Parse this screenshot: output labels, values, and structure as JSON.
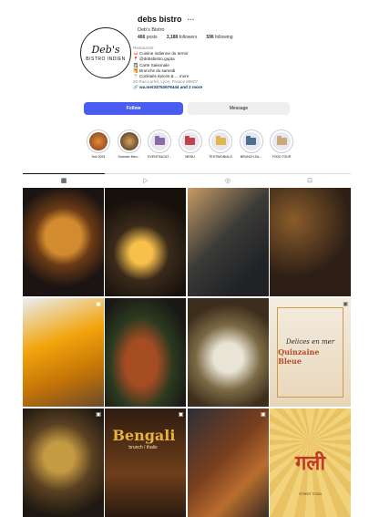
{
  "profile": {
    "username": "debs bistro",
    "more_icon": "ellipsis-icon",
    "full_name": "Deb's Bistro",
    "avatar_line1": "Deb's",
    "avatar_line2": "BISTRO INDIEN",
    "stats": {
      "posts": "466",
      "posts_label": "posts",
      "followers": "3,188",
      "followers_label": "followers",
      "following": "596",
      "following_label": "following"
    },
    "bio": {
      "category": "Restaurant",
      "lines": [
        "Cuisine indienne du terroir",
        "@debsbistro.gupta",
        "Carte Saisonale",
        "Brunchs du samedi",
        "Cocktails épicés & ... more"
      ],
      "address": "20 Rue Lorrel, Lyon, France 69007",
      "link": "wa.me/33752676444 and 2 more"
    },
    "follow_label": "Follow",
    "message_label": "Message"
  },
  "highlights": [
    {
      "label": "Holi 2024",
      "color": "#c65b2a"
    },
    {
      "label": "Summer Men...",
      "color": "#9a6b3c"
    },
    {
      "label": "EVENTS&CAT...",
      "color": "#8a6aa8"
    },
    {
      "label": "MENU",
      "color": "#c0424a"
    },
    {
      "label": "TESTIMONIALS",
      "color": "#e0b84a"
    },
    {
      "label": "BRUNCH SA...",
      "color": "#4b6f8e"
    },
    {
      "label": "FOOD TOUR",
      "color": "#c9a97a"
    }
  ],
  "tabs": [
    {
      "name": "posts-grid-icon",
      "glyph": "▦"
    },
    {
      "name": "reels-icon",
      "glyph": "▷"
    },
    {
      "name": "collab-icon",
      "glyph": "◎"
    },
    {
      "name": "tagged-icon",
      "glyph": "⊡"
    }
  ],
  "posts": {
    "reel_title": "Bengali",
    "reel_subtitle": "brunch / thalis",
    "menu_line1": "Delices en mer",
    "menu_line2": "Quinzaine Bleue",
    "hindi_title": "गली",
    "hindi_subtitle": "STREET FOOD"
  }
}
